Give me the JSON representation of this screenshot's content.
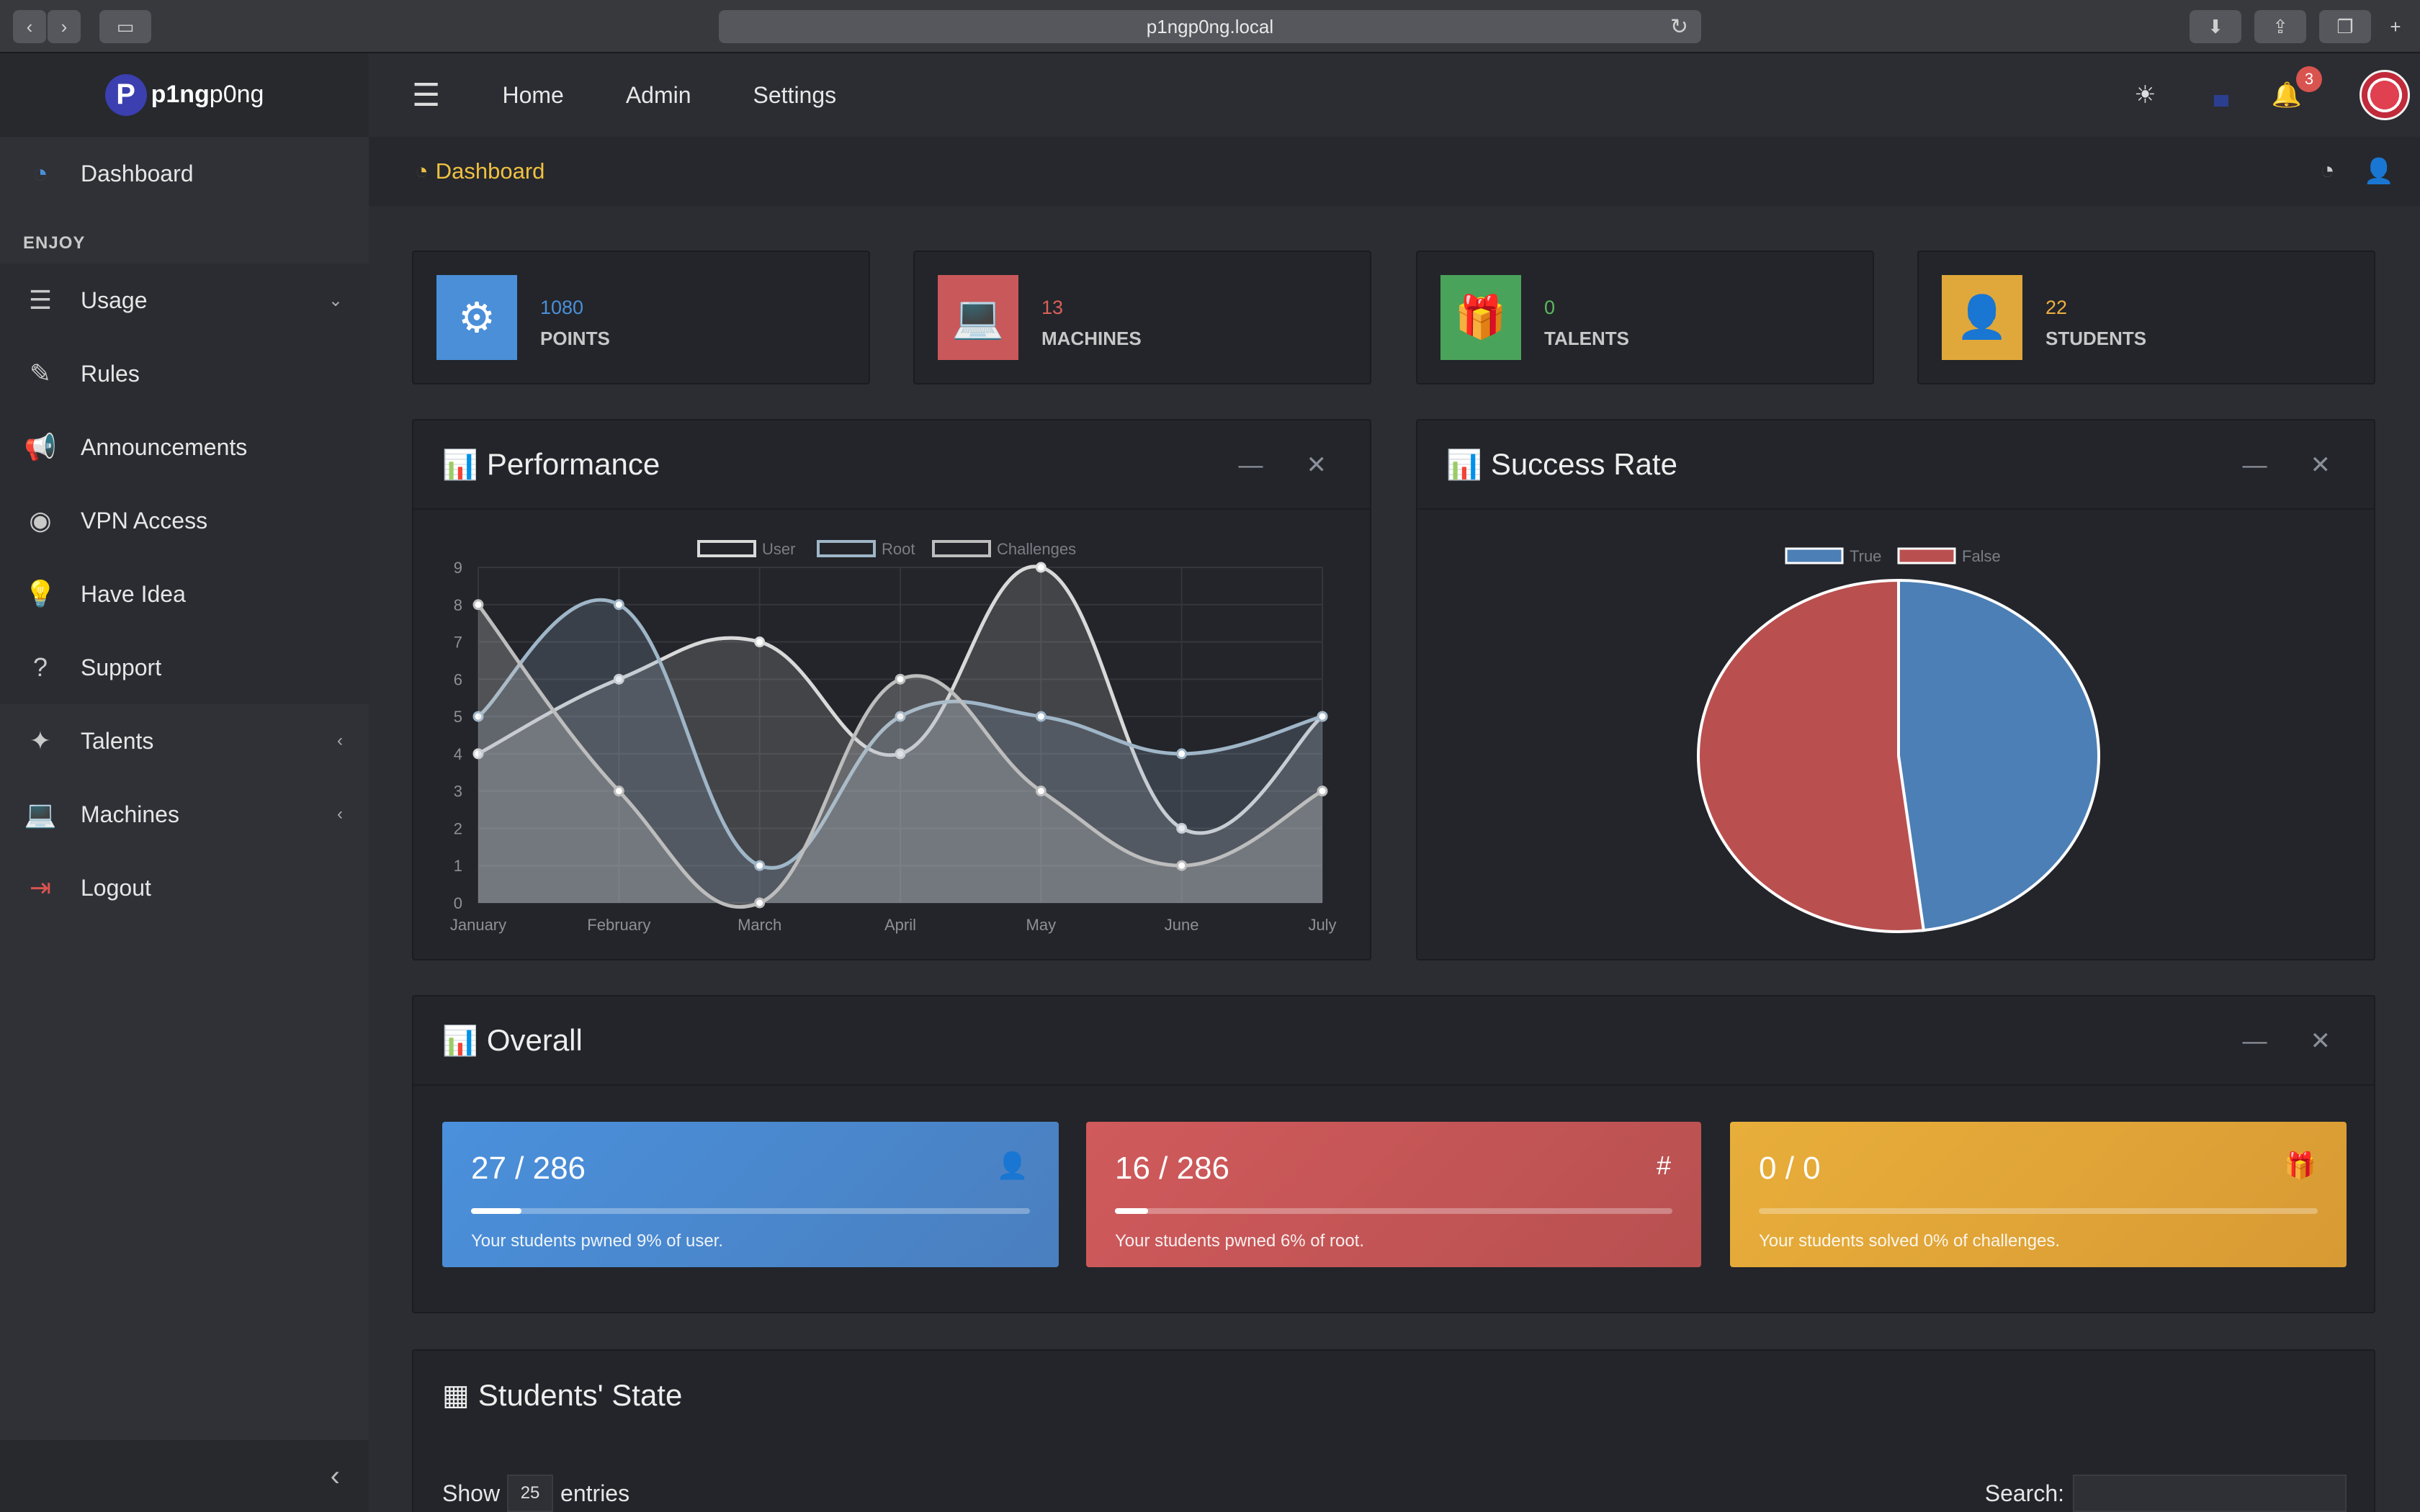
{
  "browser": {
    "url": "p1ngp0ng.local"
  },
  "brand": {
    "logo_letter": "P",
    "name_bold": "p1ng",
    "name_rest": "p0ng"
  },
  "sidebar": {
    "dashboard_label": "Dashboard",
    "section_label": "ENJOY",
    "items": [
      {
        "label": "Usage",
        "icon": "list-icon"
      },
      {
        "label": "Rules",
        "icon": "pencil-icon"
      },
      {
        "label": "Announcements",
        "icon": "megaphone-icon"
      },
      {
        "label": "VPN Access",
        "icon": "accessibility-icon"
      },
      {
        "label": "Have Idea",
        "icon": "lightbulb-icon"
      },
      {
        "label": "Support",
        "icon": "question-icon"
      },
      {
        "label": "Talents",
        "icon": "magic-wand-icon"
      },
      {
        "label": "Machines",
        "icon": "laptop-icon"
      },
      {
        "label": "Logout",
        "icon": "sign-out-icon"
      }
    ]
  },
  "topnav": {
    "links": [
      "Home",
      "Admin",
      "Settings"
    ],
    "notification_count": "3"
  },
  "breadcrumb": {
    "label": "Dashboard"
  },
  "info_boxes": [
    {
      "value": "1080",
      "label": "POINTS",
      "color": "#4a8fd8"
    },
    {
      "value": "13",
      "label": "MACHINES",
      "color": "#c9585a"
    },
    {
      "value": "0",
      "label": "TALENTS",
      "color": "#4aa35a"
    },
    {
      "value": "22",
      "label": "STUDENTS",
      "color": "#e0a83a"
    }
  ],
  "performance": {
    "title": "Performance"
  },
  "success": {
    "title": "Success Rate"
  },
  "chart_data": [
    {
      "type": "line",
      "categories": [
        "January",
        "February",
        "March",
        "April",
        "May",
        "June",
        "July"
      ],
      "ylim": [
        0,
        9
      ],
      "yticks": [
        0,
        1,
        2,
        3,
        4,
        5,
        6,
        7,
        8,
        9
      ],
      "legend_placement": "top",
      "series": [
        {
          "name": "User",
          "values": [
            4,
            6,
            7,
            4,
            9,
            2,
            5
          ],
          "color": "#d9d9d9"
        },
        {
          "name": "Root",
          "values": [
            5,
            8,
            1,
            5,
            5,
            4,
            5
          ],
          "color": "#9fb6c8"
        },
        {
          "name": "Challenges",
          "values": [
            8,
            3,
            0,
            6,
            3,
            1,
            3
          ],
          "color": "#bdbdbd"
        }
      ]
    },
    {
      "type": "pie",
      "legend_placement": "top",
      "slices": [
        {
          "name": "True",
          "value": 48,
          "color": "#4c7fb6"
        },
        {
          "name": "False",
          "value": 52,
          "color": "#b9504f"
        }
      ]
    }
  ],
  "overall": {
    "title": "Overall",
    "cards": [
      {
        "value": "27 / 286",
        "percent": 9,
        "desc": "Your students pwned 9% of user.",
        "icon": "user-icon",
        "glyph": "👤"
      },
      {
        "value": "16 / 286",
        "percent": 6,
        "desc": "Your students pwned 6% of root.",
        "icon": "hash-icon",
        "glyph": "#"
      },
      {
        "value": "0 / 0",
        "percent": 0,
        "desc": "Your students solved 0% of challenges.",
        "icon": "gift-icon",
        "glyph": "🎁"
      }
    ]
  },
  "students_state": {
    "title": "Students' State",
    "show_label": "Show",
    "entries_value": "25",
    "entries_label": "entries",
    "search_label": "Search:"
  }
}
